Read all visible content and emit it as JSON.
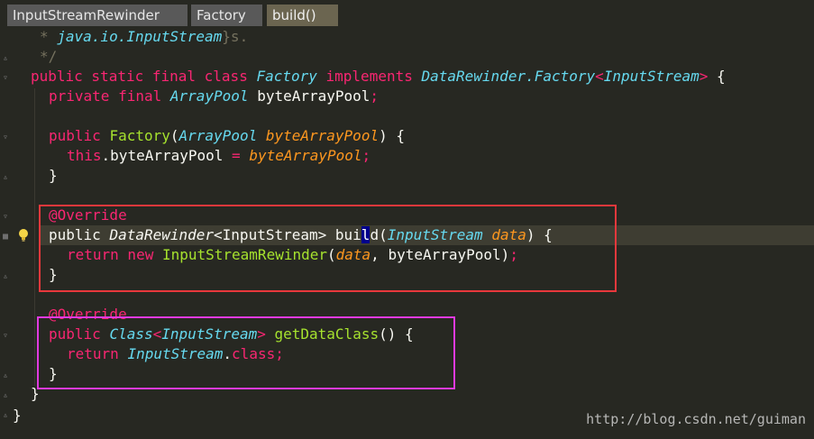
{
  "breadcrumbs": [
    "InputStreamRewinder",
    "Factory",
    "build()"
  ],
  "code": {
    "line1": {
      "star": "* ",
      "ref": "java.io.InputStream",
      "rest": "}s."
    },
    "line2": "*/",
    "line3": {
      "kw": "public static final class ",
      "name": "Factory",
      "impl": " implements ",
      "iface": "DataRewinder.Factory",
      "lt": "<",
      "param": "InputStream",
      "gt": ">",
      "brace": " {"
    },
    "line4": {
      "kw": "private final ",
      "type": "ArrayPool",
      "field": " byteArrayPool",
      "semi": ";"
    },
    "line5": {
      "kw": "public ",
      "name": "Factory",
      "open": "(",
      "type": "ArrayPool",
      "param": " byteArrayPool",
      "close": ") {"
    },
    "line6": {
      "kw": "this",
      "dot": ".",
      "field": "byteArrayPool",
      "eq": " = ",
      "val": "byteArrayPool",
      "semi": ";"
    },
    "line7": "}",
    "line8": "@Override",
    "line9": {
      "kw": "public ",
      "type": "DataRewinder",
      "gen": "<InputStream> ",
      "m1": "bui",
      "mh": "l",
      "m2": "d",
      "open": "(",
      "ptype": "InputStream",
      "pname": " data",
      "close": ") {"
    },
    "line10": {
      "kw": "return new ",
      "cls": "InputStreamRewinder",
      "open": "(",
      "arg": "data",
      "rest": ", byteArrayPool",
      "close": ")",
      "semi": ";"
    },
    "line11": "}",
    "line12": "@Override",
    "line13": {
      "kw": "public ",
      "type": "Class",
      "lt": "<",
      "param": "InputStream",
      "gt": ">",
      "name": " getDataClass",
      "rest": "() {"
    },
    "line14": {
      "kw": "return ",
      "type": "InputStream",
      "dot": ".",
      "cls": "class",
      "semi": ";"
    },
    "line15": "}",
    "line16": "}",
    "line17": "}"
  },
  "watermark": "http://blog.csdn.net/guiman",
  "colors": {
    "background": "#272822",
    "keyword": "#f92672",
    "type": "#66d9ef",
    "function": "#a6e22e",
    "parameter": "#fd971f",
    "highlight_box_1": "#e8383c",
    "highlight_box_2": "#e03ae0"
  }
}
